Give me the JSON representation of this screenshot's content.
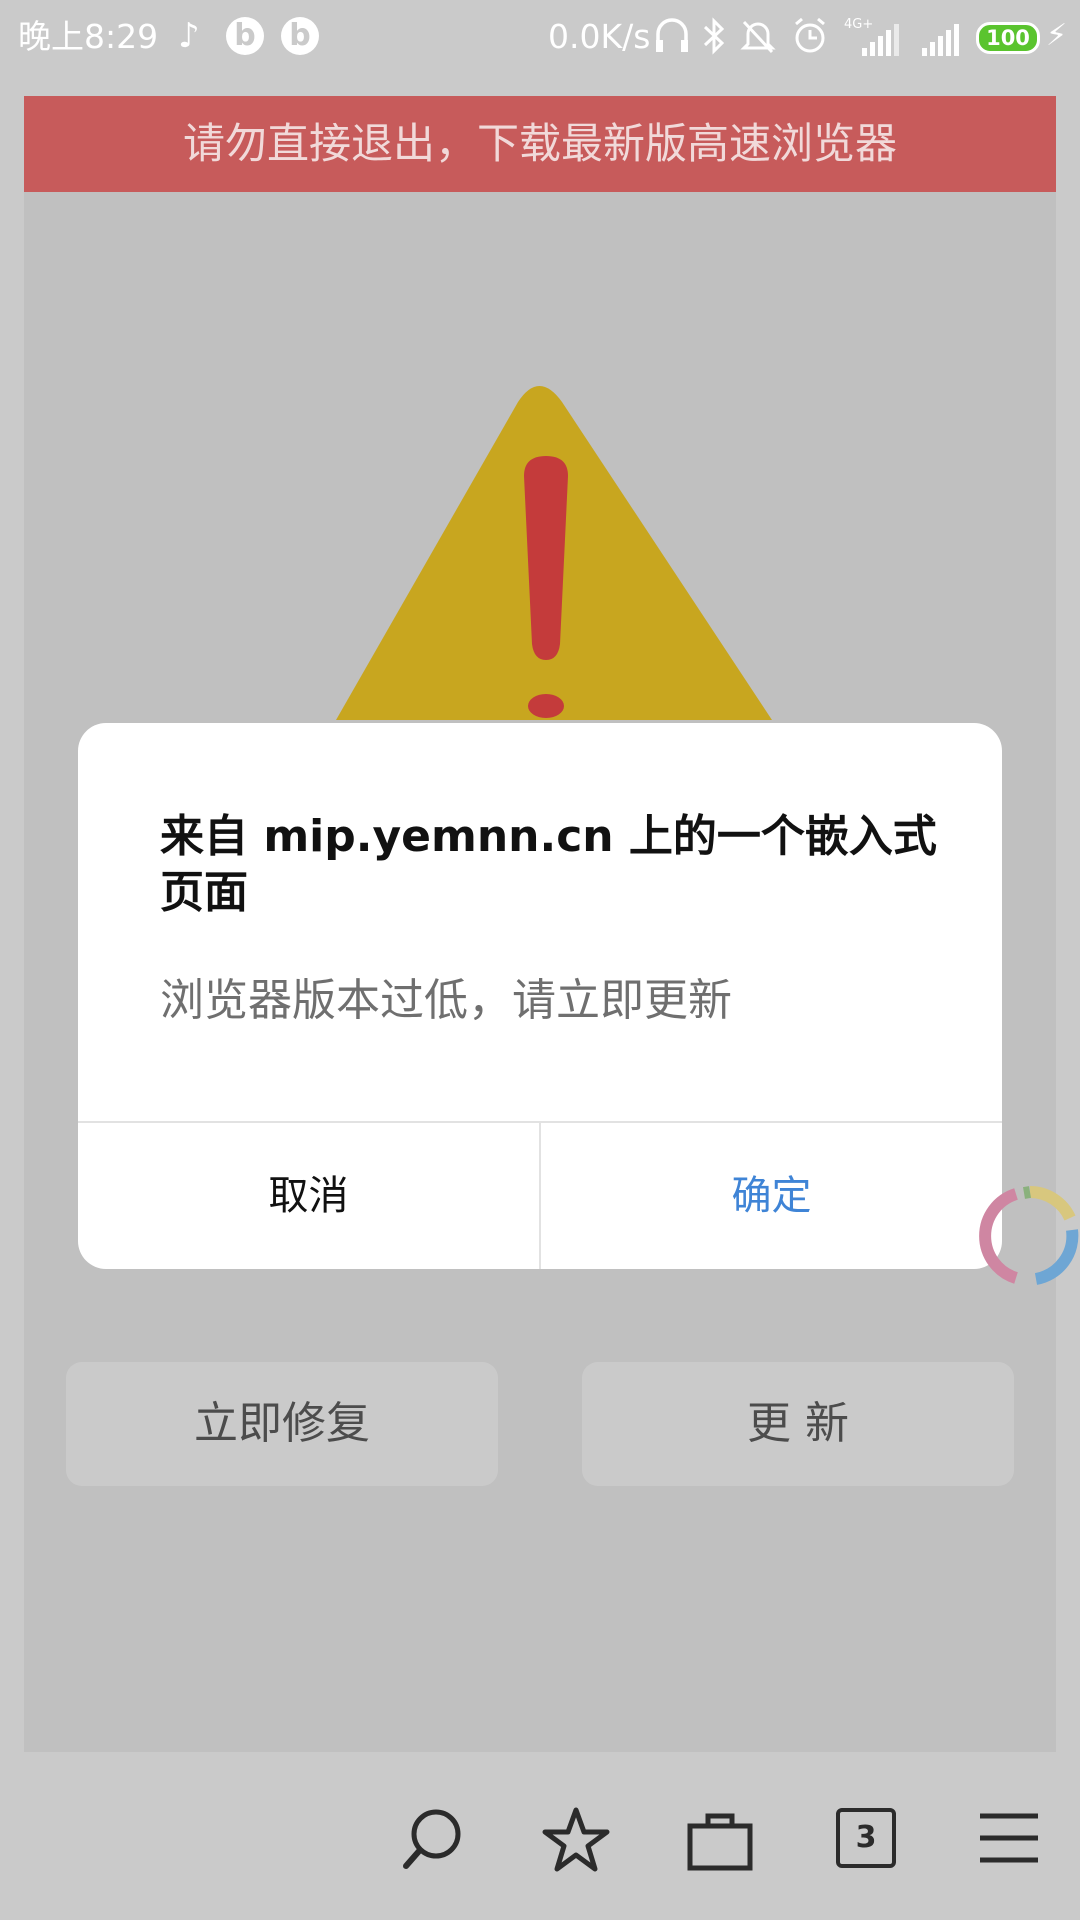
{
  "status_bar": {
    "time": "晚上8:29",
    "net_speed": "0.0K/s",
    "battery_level": "100",
    "network_type": "4G+",
    "icons": [
      "music-note-icon",
      "bilibili-icon",
      "bilibili-icon",
      "headphones-icon",
      "bluetooth-icon",
      "mute-icon",
      "alarm-icon",
      "signal-icon",
      "signal-icon",
      "battery-icon",
      "charging-icon"
    ]
  },
  "page": {
    "banner_text": "请勿直接退出，下载最新版高速浏览器",
    "repair_button": "立即修复",
    "update_button": "更 新",
    "colors": {
      "banner": "#c75b5b",
      "warning_triangle": "#c8a61f",
      "exclamation": "#c43b3b"
    }
  },
  "dialog": {
    "title": "来自 mip.yemnn.cn 上的一个嵌入式页面",
    "message": "浏览器版本过低，请立即更新",
    "cancel_label": "取消",
    "ok_label": "确定",
    "accent_color": "#3f84d6"
  },
  "toolbar": {
    "tab_count": "3",
    "icons": [
      "search-icon",
      "star-icon",
      "bag-icon",
      "tabs-icon",
      "menu-icon"
    ]
  }
}
